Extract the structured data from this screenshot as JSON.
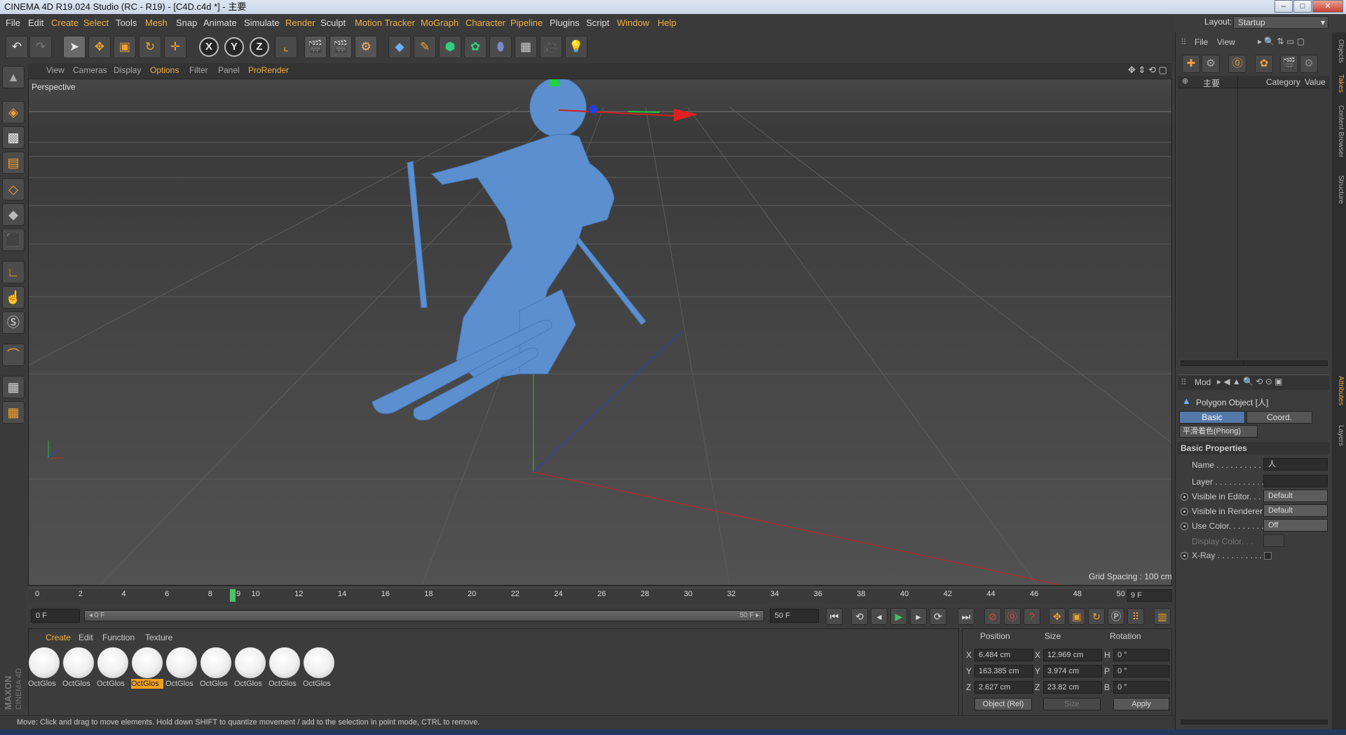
{
  "window": {
    "title": "CINEMA 4D R19.024 Studio (RC - R19) - [C4D.c4d *] - 主要",
    "min": "–",
    "max": "□",
    "close": "✕"
  },
  "menubar": [
    "File",
    "Edit",
    "Create",
    "Select",
    "Tools",
    "Mesh",
    "Snap",
    "Animate",
    "Simulate",
    "Render",
    "Sculpt",
    "Motion Tracker",
    "MoGraph",
    "Character",
    "Pipeline",
    "Plugins",
    "Script",
    "Window",
    "Help"
  ],
  "layout": {
    "label": "Layout:",
    "value": "Startup"
  },
  "viewport": {
    "menu": [
      "View",
      "Cameras",
      "Display",
      "Options",
      "Filter",
      "Panel",
      "ProRender"
    ],
    "label": "Perspective",
    "grid_spacing": "Grid Spacing : 100 cm"
  },
  "timeline": {
    "ticks": [
      "0",
      "2",
      "4",
      "6",
      "8",
      "10",
      "12",
      "14",
      "16",
      "18",
      "20",
      "22",
      "24",
      "26",
      "28",
      "30",
      "32",
      "34",
      "36",
      "38",
      "40",
      "42",
      "44",
      "46",
      "48",
      "50"
    ],
    "current_marker": "9",
    "current_frame": "9 F",
    "start_field": "0 F",
    "range_start": "◂ 0 F",
    "range_end": "50 F ▸",
    "end_field": "50 F"
  },
  "materials": {
    "menu": [
      "Create",
      "Edit",
      "Function",
      "Texture"
    ],
    "items": [
      "OctGlos",
      "OctGlos",
      "OctGlos",
      "OctGlos",
      "OctGlos",
      "OctGlos",
      "OctGlos",
      "OctGlos",
      "OctGlos"
    ],
    "selected_index": 3
  },
  "coords": {
    "headers": {
      "position": "Position",
      "size": "Size",
      "rotation": "Rotation"
    },
    "rows": [
      {
        "axis": "X",
        "pos": "6.484 cm",
        "size_axis": "X",
        "size": "12.969 cm",
        "rot_axis": "H",
        "rot": "0 °"
      },
      {
        "axis": "Y",
        "pos": "163.385 cm",
        "size_axis": "Y",
        "size": "3.974 cm",
        "rot_axis": "P",
        "rot": "0 °"
      },
      {
        "axis": "Z",
        "pos": "2.627 cm",
        "size_axis": "Z",
        "size": "23.82 cm",
        "rot_axis": "B",
        "rot": "0 °"
      }
    ],
    "mode": "Object (Rel)",
    "size_mode": "Size",
    "apply": "Apply"
  },
  "vendor": {
    "line1": "MAXON",
    "line2": "CINEMA 4D"
  },
  "status": "Move: Click and drag to move elements. Hold down SHIFT to quantize movement / add to the selection in point mode, CTRL to remove.",
  "objects_panel": {
    "menu": [
      "File",
      "View"
    ],
    "object": "主要",
    "col_category": "Category",
    "col_value": "Value"
  },
  "attributes": {
    "mode": "Mod",
    "title": "Polygon Object [人]",
    "tabs": [
      "Basic",
      "Coord."
    ],
    "phong": "平滑着色(Phong)",
    "section": "Basic Properties",
    "fields": [
      {
        "label": "Name . . . . . . . . . . .",
        "value": "人"
      },
      {
        "label": "Layer . . . . . . . . . . .",
        "value": ""
      },
      {
        "label": "Visible in Editor. . .",
        "value": "Default"
      },
      {
        "label": "Visible in Renderer",
        "value": "Default"
      },
      {
        "label": "Use Color. . . . . . . .",
        "value": "Off"
      },
      {
        "label": "Display Color. . .",
        "value": ""
      },
      {
        "label": "X-Ray . . . . . . . . . .",
        "value": ""
      }
    ]
  },
  "side_tabs": [
    "Objects",
    "Takes",
    "Content Browser",
    "Structure",
    "Attributes",
    "Layers"
  ],
  "colors": {
    "accent": "#f0a030",
    "skier": "#5b8fd0",
    "x_axis": "#d02020",
    "y_axis": "#20c040",
    "z_axis": "#2040e0"
  }
}
